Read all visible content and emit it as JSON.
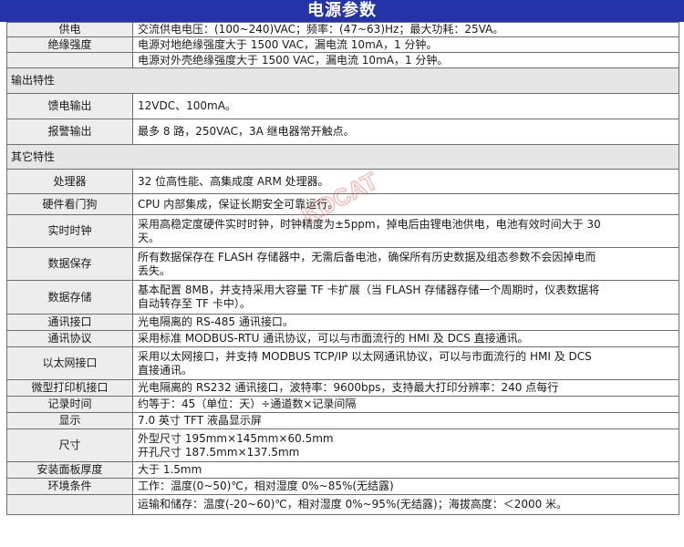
{
  "title": "电源参数",
  "rows": [
    {
      "type": "row",
      "label": "供电",
      "lines": [
        "交流供电电压：(100~240)VAC；频率：(47~63)Hz；最大功耗：25VA。"
      ]
    },
    {
      "type": "row",
      "label": "绝缘强度",
      "lines": [
        "电源对地绝缘强度大于 1500 VAC，漏电流 10mA，1 分钟。"
      ]
    },
    {
      "type": "row",
      "label": "",
      "lines": [
        "电源对外壳绝缘强度大于 1500 VAC，漏电流 10mA，1 分钟。"
      ]
    },
    {
      "type": "section",
      "label": "输出特性"
    },
    {
      "type": "row",
      "label": "馈电输出",
      "lines": [
        "12VDC、100mA。"
      ]
    },
    {
      "type": "row",
      "label": "报警输出",
      "lines": [
        "最多 8 路，250VAC，3A 继电器常开触点。"
      ]
    },
    {
      "type": "section",
      "label": "其它特性"
    },
    {
      "type": "row",
      "label": "处理器",
      "lines": [
        "32 位高性能、高集成度 ARM 处理器。"
      ]
    },
    {
      "type": "row",
      "label": "硬件看门狗",
      "lines": [
        "CPU 内部集成，保证长期安全可靠运行。"
      ]
    },
    {
      "type": "row",
      "label": "实时时钟",
      "lines": [
        "采用高稳定度硬件实时时钟，时钟精度为±5ppm，掉电后由锂电池供电，电池有效时间大于 30",
        "天。"
      ]
    },
    {
      "type": "row",
      "label": "数据保存",
      "lines": [
        "所有数据保存在 FLASH 存储器中，无需后备电池，确保所有历史数据及组态参数不会因掉电而",
        "丢失。"
      ]
    },
    {
      "type": "row",
      "label": "数据存储",
      "lines": [
        "基本配置 8MB，并支持采用大容量 TF 卡扩展（当 FLASH 存储器存储一个周期时，仪表数据将",
        "自动转存至 TF 卡中）。"
      ]
    },
    {
      "type": "row",
      "label": "通讯接口",
      "lines": [
        "光电隔离的 RS-485 通讯接口。"
      ]
    },
    {
      "type": "row",
      "label": "通讯协议",
      "lines": [
        "采用标准 MODBUS-RTU 通讯协议，可以与市面流行的 HMI 及 DCS 直接通讯。"
      ]
    },
    {
      "type": "row",
      "label": "以太网接口",
      "lines": [
        "采用以太网接口，并支持 MODBUS TCP/IP 以太网通讯协议，可以与市面流行的 HMI 及 DCS",
        "直接通讯。"
      ]
    },
    {
      "type": "row",
      "label": "微型打印机接口",
      "lines": [
        "光电隔离的 RS232 通讯接口，波特率：9600bps，支持最大打印分辨率：240 点每行"
      ]
    },
    {
      "type": "row",
      "label": "记录时间",
      "lines": [
        "约等于：45（单位：天）÷通道数×记录间隔"
      ]
    },
    {
      "type": "row",
      "label": "显示",
      "lines": [
        "7.0 英寸 TFT 液晶显示屏"
      ]
    },
    {
      "type": "row",
      "label": "尺寸",
      "lines": [
        "外型尺寸  195mm×145mm×60.5mm",
        "开孔尺寸  187.5mm×137.5mm"
      ]
    },
    {
      "type": "row",
      "label": "安装面板厚度",
      "lines": [
        "大于 1.5mm"
      ]
    },
    {
      "type": "row",
      "label": "环境条件",
      "lines": [
        "工作：温度(0~50)℃，相对湿度 0%~85%(无结露)"
      ]
    },
    {
      "type": "row",
      "label": "",
      "lines": [
        "运输和储存：温度(-20~60)℃，相对湿度 0%~95%(无结露)；海拔高度：＜2000 米。"
      ]
    }
  ],
  "watermark": {
    "text": "KDCAT",
    "color": "#d9534f"
  }
}
